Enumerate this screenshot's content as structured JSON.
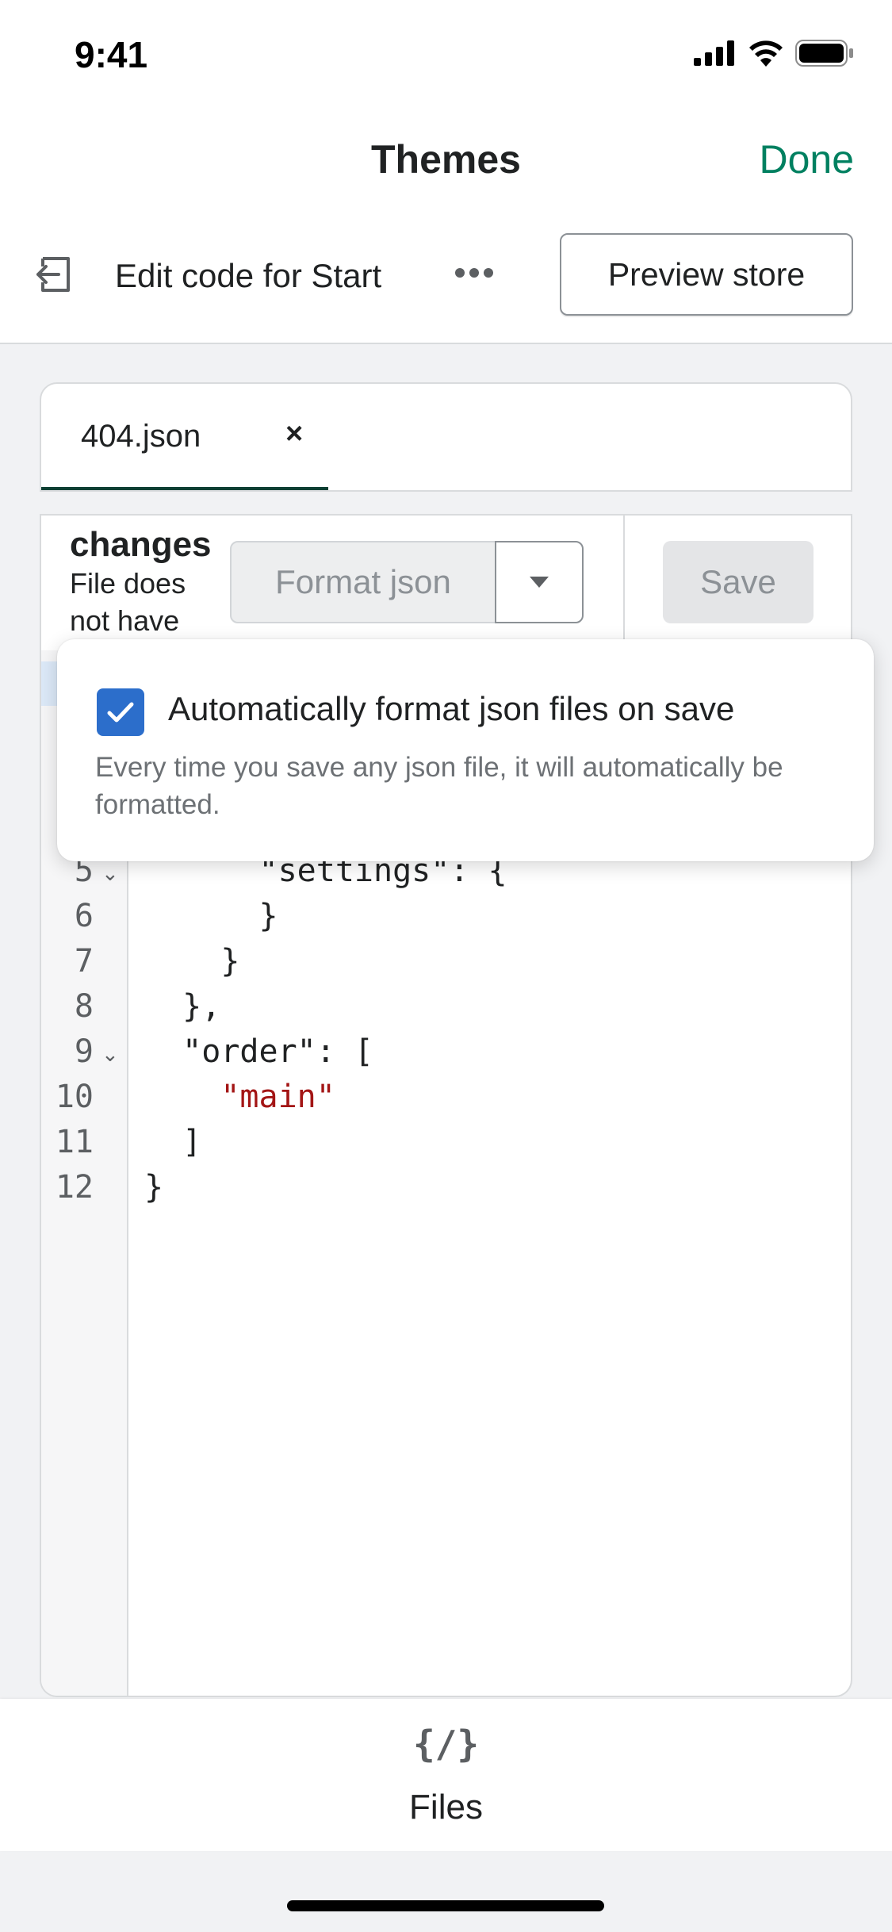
{
  "status_bar": {
    "time": "9:41"
  },
  "nav": {
    "title": "Themes",
    "done_label": "Done"
  },
  "toolbar": {
    "title": "Edit code for Start",
    "preview_label": "Preview store"
  },
  "tab": {
    "label": "404.json",
    "close_glyph": "×"
  },
  "editor_header": {
    "status_strong": "changes",
    "status_line1": "File does",
    "status_line2": "not have",
    "format_label": "Format json",
    "save_label": "Save"
  },
  "popover": {
    "checkbox_label": "Automatically format json files on save",
    "checkbox_checked": true,
    "help_text": "Every time you save any json file, it will automatically be formatted."
  },
  "code": {
    "lines": [
      {
        "n": "5",
        "text": "      \"settings\": {"
      },
      {
        "n": "6",
        "text": "      }"
      },
      {
        "n": "7",
        "text": "    }"
      },
      {
        "n": "8",
        "text": "  },"
      },
      {
        "n": "9",
        "text": "  \"order\": ["
      },
      {
        "n": "10",
        "text": "    \"main\""
      },
      {
        "n": "11",
        "text": "  ]"
      },
      {
        "n": "12",
        "text": "}"
      }
    ]
  },
  "bottom_bar": {
    "files_icon_glyph": "{/}",
    "files_label": "Files"
  },
  "colors": {
    "accent": "#008060",
    "checkbox": "#2c6ecb",
    "string": "#a31515"
  }
}
